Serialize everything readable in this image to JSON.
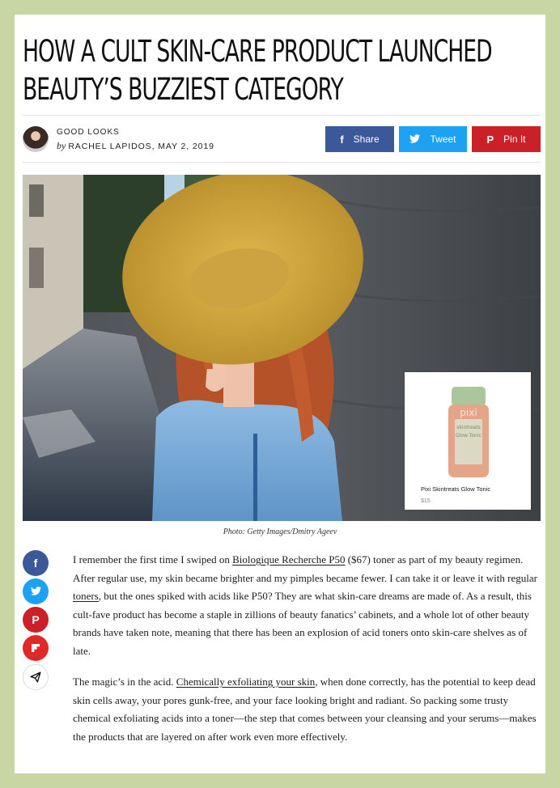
{
  "article": {
    "title": "How a Cult Skin-Care Product Launched Beauty’s Buzziest Category",
    "section": "GOOD LOOKS",
    "by": "by",
    "author_date": "RACHEL LAPIDOS, MAY 2, 2019"
  },
  "share": {
    "facebook": "Share",
    "twitter": "Tweet",
    "pinterest": "Pin It"
  },
  "colors": {
    "facebook": "#3b5998",
    "twitter": "#1da1f2",
    "pinterest": "#cb2027",
    "flipboard": "#e12828",
    "page_bg": "#c7d6a3"
  },
  "icons": {
    "facebook": "facebook-icon",
    "twitter": "twitter-icon",
    "pinterest": "pinterest-icon",
    "flipboard": "flipboard-icon",
    "send": "send-icon"
  },
  "product": {
    "brand": "pixi",
    "line": "skintreats",
    "variant": "Glow Tonic",
    "name": "Pixi Skintreats Glow Tonic",
    "price": "$15"
  },
  "caption": "Photo: Getty Images/Dmitry Ageev",
  "paragraph1": {
    "t1": "I remember the first time I swiped on ",
    "link1": "Biologique Recherche P50",
    "t2": " ($67) toner as part of my beauty regimen. After regular use, my skin became brighter and my pimples became fewer. I can take it or leave it with regular ",
    "link2": "toners",
    "t3": ", but the ones spiked with acids like P50? They are what skin-care dreams are made of. As a result, this cult-fave product has become a staple in zillions of beauty fanatics’ cabinets, and a whole lot of other beauty brands have taken note, meaning that there has been an explosion of acid toners onto skin-care shelves as of late."
  },
  "paragraph2": {
    "t1": "The magic’s in the acid. ",
    "link1": "Chemically exfoliating your skin",
    "t2": ", when done correctly, has the potential to keep dead skin cells away, your pores gunk-free, and your face looking bright and radiant. So packing some trusty chemical exfoliating acids into a toner—the step that comes between your cleansing and your serums—makes the products that are layered on after work even more effectively."
  }
}
